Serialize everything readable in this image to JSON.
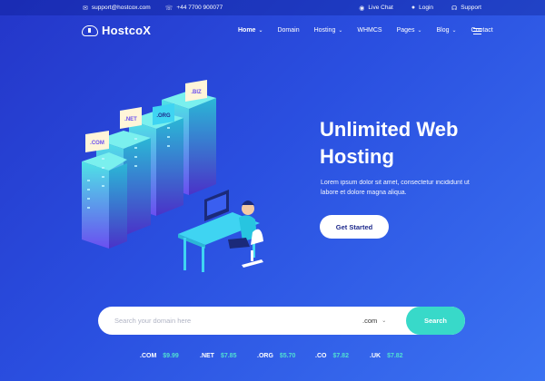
{
  "topbar": {
    "email": "support@hostcox.com",
    "phone": "+44 7700 900077",
    "live_chat": "Live Chat",
    "login": "Login",
    "support": "Support"
  },
  "nav": {
    "logo": "HostcoX",
    "items": [
      {
        "label": "Home",
        "dropdown": true
      },
      {
        "label": "Domain",
        "dropdown": false
      },
      {
        "label": "Hosting",
        "dropdown": true
      },
      {
        "label": "WHMCS",
        "dropdown": false
      },
      {
        "label": "Pages",
        "dropdown": true
      },
      {
        "label": "Blog",
        "dropdown": true
      },
      {
        "label": "Contact",
        "dropdown": false
      }
    ]
  },
  "hero": {
    "title_line1": "Unlimited Web",
    "title_line2": "Hosting",
    "description": "Lorem ipsum dolor sit amet, consectetur incididunt ut labore et dolore magna aliqua.",
    "cta": "Get Started",
    "server_tags": [
      ".COM",
      ".NET",
      ".ORG",
      ".BIZ"
    ]
  },
  "search": {
    "placeholder": "Search your domain here",
    "tld_selected": ".com",
    "button": "Search"
  },
  "prices": [
    {
      "tld": ".COM",
      "price": "$9.99"
    },
    {
      "tld": ".NET",
      "price": "$7.85"
    },
    {
      "tld": ".ORG",
      "price": "$5.70"
    },
    {
      "tld": ".CO",
      "price": "$7.82"
    },
    {
      "tld": ".UK",
      "price": "$7.82"
    }
  ],
  "colors": {
    "accent": "#38d9c9",
    "price": "#50e0d2",
    "background": "#2a4fe0",
    "cta_text": "#1e2a8c"
  }
}
